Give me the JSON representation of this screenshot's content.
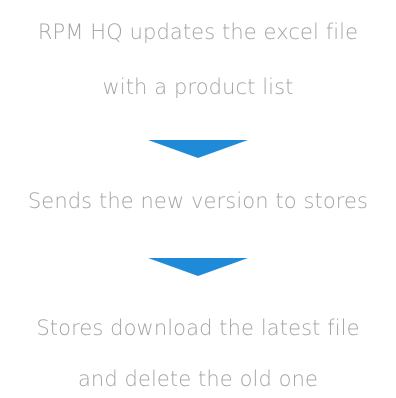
{
  "steps": [
    {
      "line1": "RPM HQ updates the excel file",
      "line2": "with a product list"
    },
    {
      "line1": "Sends the new version to stores"
    },
    {
      "line1": "Stores download the latest file",
      "line2": "and delete the old one"
    }
  ],
  "arrow_color": "#1f8ad8",
  "text_color": "#a3a3a3",
  "arrow_icon": "chevron-down-triangle"
}
